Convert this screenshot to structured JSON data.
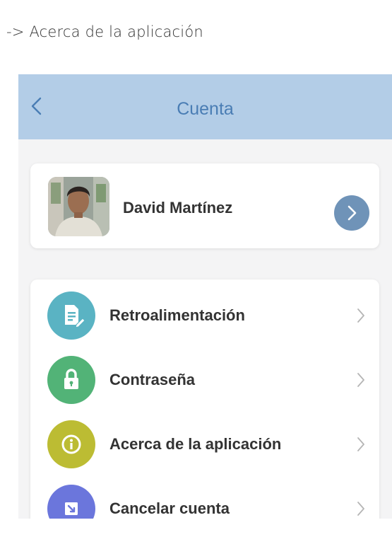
{
  "caption": "-> Acerca de la aplicación",
  "header": {
    "title": "Cuenta",
    "back_icon": "chevron-left-icon"
  },
  "profile": {
    "name": "David Martínez",
    "avatar": "user-photo",
    "arrow_icon": "chevron-right-circle-icon"
  },
  "menu": {
    "items": [
      {
        "label": "Retroalimentación",
        "icon": "feedback-document-icon",
        "color": "#5ab3c3"
      },
      {
        "label": "Contraseña",
        "icon": "lock-icon",
        "color": "#52b377"
      },
      {
        "label": "Acerca de la aplicación",
        "icon": "info-icon",
        "color": "#bcbc33"
      },
      {
        "label": "Cancelar cuenta",
        "icon": "cancel-account-icon",
        "color": "#6b76dc"
      }
    ]
  },
  "colors": {
    "header_bg": "#b3cde7",
    "header_title": "#4a7db4",
    "profile_arrow_bg": "#6f93b8",
    "page_bg": "#f4f4f5"
  }
}
